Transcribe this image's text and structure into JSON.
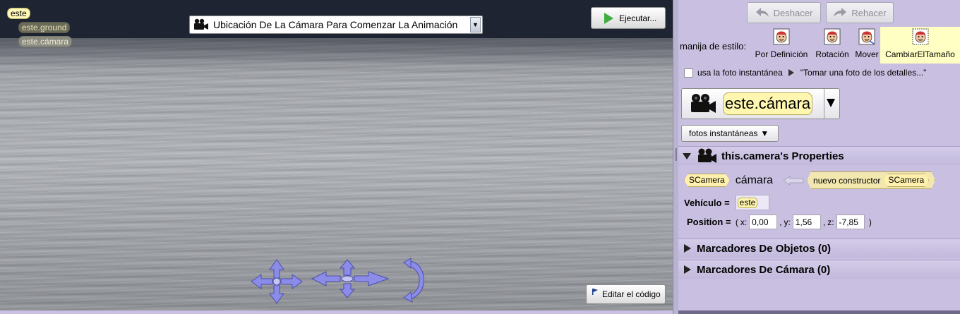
{
  "scene": {
    "tags": {
      "root": "este",
      "ground": "este.ground",
      "camera": "este.cámara"
    },
    "camera_select": {
      "label": "Ubicación De La Cámara Para Comenzar La Animación"
    },
    "run_button": "Ejecutar...",
    "edit_code_button": "Editar el código"
  },
  "panel": {
    "undo": "Deshacer",
    "redo": "Rehacer",
    "style_label": "manija de estilo:",
    "styles": [
      {
        "label": "Por Definición",
        "icon": "default-style-face-icon"
      },
      {
        "label": "Rotación",
        "icon": "rotate-style-face-icon"
      },
      {
        "label": "Mover",
        "icon": "move-style-face-icon"
      },
      {
        "label": "CambiarElTamaño",
        "icon": "resize-style-face-icon",
        "selected": true
      }
    ],
    "snapshot": {
      "checked": false,
      "label": "usa la foto instantánea",
      "hint": "\"Tomar una foto de los detalles...\""
    },
    "selected_entity": "este.cámara",
    "snapshots_button": "fotos instantáneas",
    "properties": {
      "title": "this.camera's Properties",
      "declaration": {
        "type": "SCamera",
        "name": "cámara",
        "ctor_label": "nuevo constructor",
        "ctor_type": "SCamera"
      },
      "vehicle_label": "Vehículo =",
      "vehicle_value": "este",
      "position_label": "Position =",
      "position": {
        "x_label": "x:",
        "x": "0,00",
        "y_label": "y:",
        "y": "1,56",
        "z_label": "z:",
        "z": "-7,85"
      }
    },
    "object_markers": "Marcadores De Objetos (0)",
    "camera_markers": "Marcadores De Cámara (0)"
  },
  "colors": {
    "panel_bg": "#c9c0e1",
    "sky": "#1e2431",
    "chip_yellow": "#fff7b0",
    "selected_style_bg": "#ffffc4",
    "run_green": "#3fae3f",
    "handle_blue": "#8a8ce8"
  }
}
